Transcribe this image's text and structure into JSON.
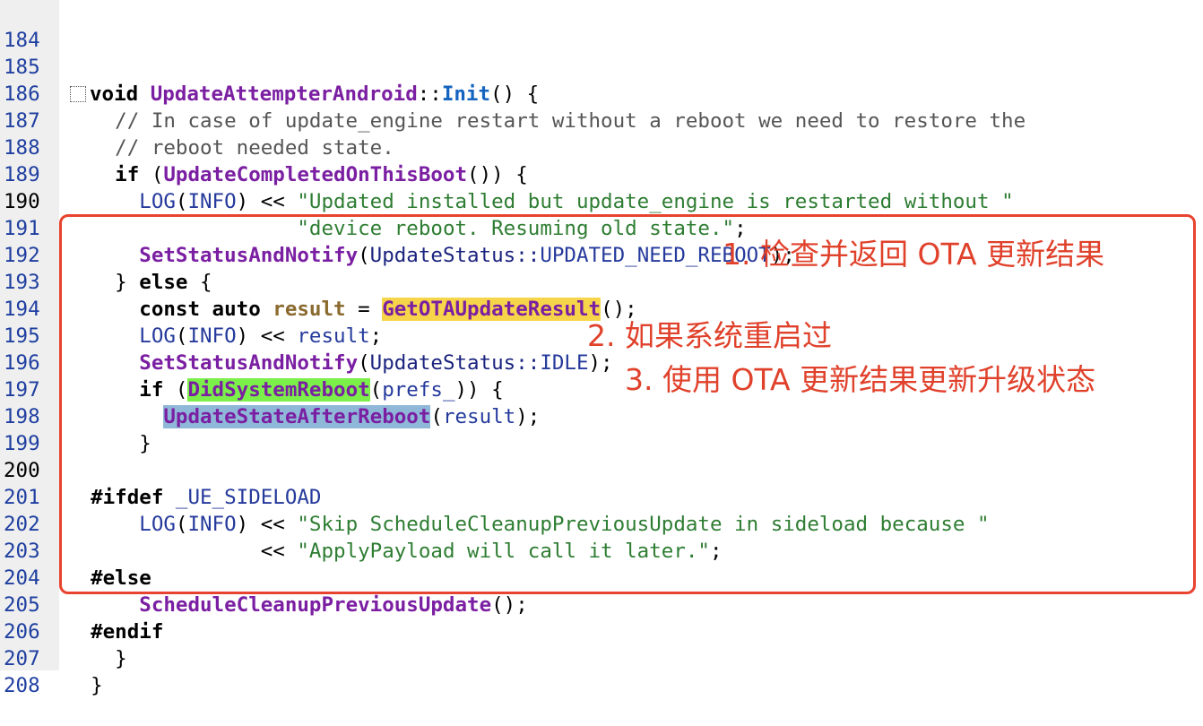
{
  "lines": [
    {
      "n": "184"
    },
    {
      "n": "185"
    },
    {
      "n": "186"
    },
    {
      "n": "187"
    },
    {
      "n": "188"
    },
    {
      "n": "189"
    },
    {
      "n": "190"
    },
    {
      "n": "191"
    },
    {
      "n": "192"
    },
    {
      "n": "193"
    },
    {
      "n": "194"
    },
    {
      "n": "195"
    },
    {
      "n": "196"
    },
    {
      "n": "197"
    },
    {
      "n": "198"
    },
    {
      "n": "199"
    },
    {
      "n": "200"
    },
    {
      "n": "201"
    },
    {
      "n": "202"
    },
    {
      "n": "203"
    },
    {
      "n": "204"
    },
    {
      "n": "205"
    },
    {
      "n": "206"
    },
    {
      "n": "207"
    },
    {
      "n": "208"
    }
  ],
  "code": {
    "l185": [
      "void ",
      "UpdateAttempterAndroid",
      "::",
      "Init",
      "() {"
    ],
    "l186": "    // In case of update_engine restart without a reboot we need to restore the",
    "l187": "    // reboot needed state.",
    "l188": [
      "    if ",
      "(",
      "UpdateCompletedOnThisBoot",
      "()) {"
    ],
    "l189": [
      "      ",
      "LOG",
      "(",
      "INFO",
      ") << ",
      "\"Updated installed but update_engine is restarted without \""
    ],
    "l190": [
      "                   ",
      "\"device reboot. Resuming old state.\"",
      ";"
    ],
    "l191": [
      "      ",
      "SetStatusAndNotify",
      "(",
      "UpdateStatus::",
      "UPDATED_NEED_REBOOT",
      ");"
    ],
    "l192": [
      "    } ",
      "else",
      " {"
    ],
    "l193": [
      "      ",
      "const auto ",
      "result",
      " = ",
      "GetOTAUpdateResult",
      "();"
    ],
    "l194": [
      "      ",
      "LOG",
      "(",
      "INFO",
      ") << ",
      "result",
      ";"
    ],
    "l195": [
      "      ",
      "SetStatusAndNotify",
      "(",
      "UpdateStatus::",
      "IDLE",
      ");"
    ],
    "l196": [
      "      ",
      "if",
      " (",
      "DidSystemReboot",
      "(",
      "prefs_",
      ")) {"
    ],
    "l197": [
      "        ",
      "UpdateStateAfterReboot",
      "(",
      "result",
      ");"
    ],
    "l198": "      }",
    "l200": [
      "  ",
      "#ifdef",
      " ",
      "_UE_SIDELOAD"
    ],
    "l201": [
      "      ",
      "LOG",
      "(",
      "INFO",
      ") << ",
      "\"Skip ScheduleCleanupPreviousUpdate in sideload because \""
    ],
    "l202": [
      "                ",
      "<< ",
      "\"ApplyPayload will call it later.\"",
      ";"
    ],
    "l203": [
      "  ",
      "#else"
    ],
    "l204": [
      "      ",
      "ScheduleCleanupPreviousUpdate",
      "();"
    ],
    "l205": [
      "  ",
      "#endif"
    ],
    "l206": "    }",
    "l207": "  }"
  },
  "annotations": {
    "a1": "1. 检查并返回 OTA 更新结果",
    "a2": "2. 如果系统重启过",
    "a3": "3. 使用 OTA 更新结果更新升级状态"
  },
  "colors": {
    "annotation_red": "#e0412b",
    "highlight_yellow": "#f7d54a",
    "highlight_green": "#7cf04a",
    "highlight_blue": "#8fb8d8"
  }
}
